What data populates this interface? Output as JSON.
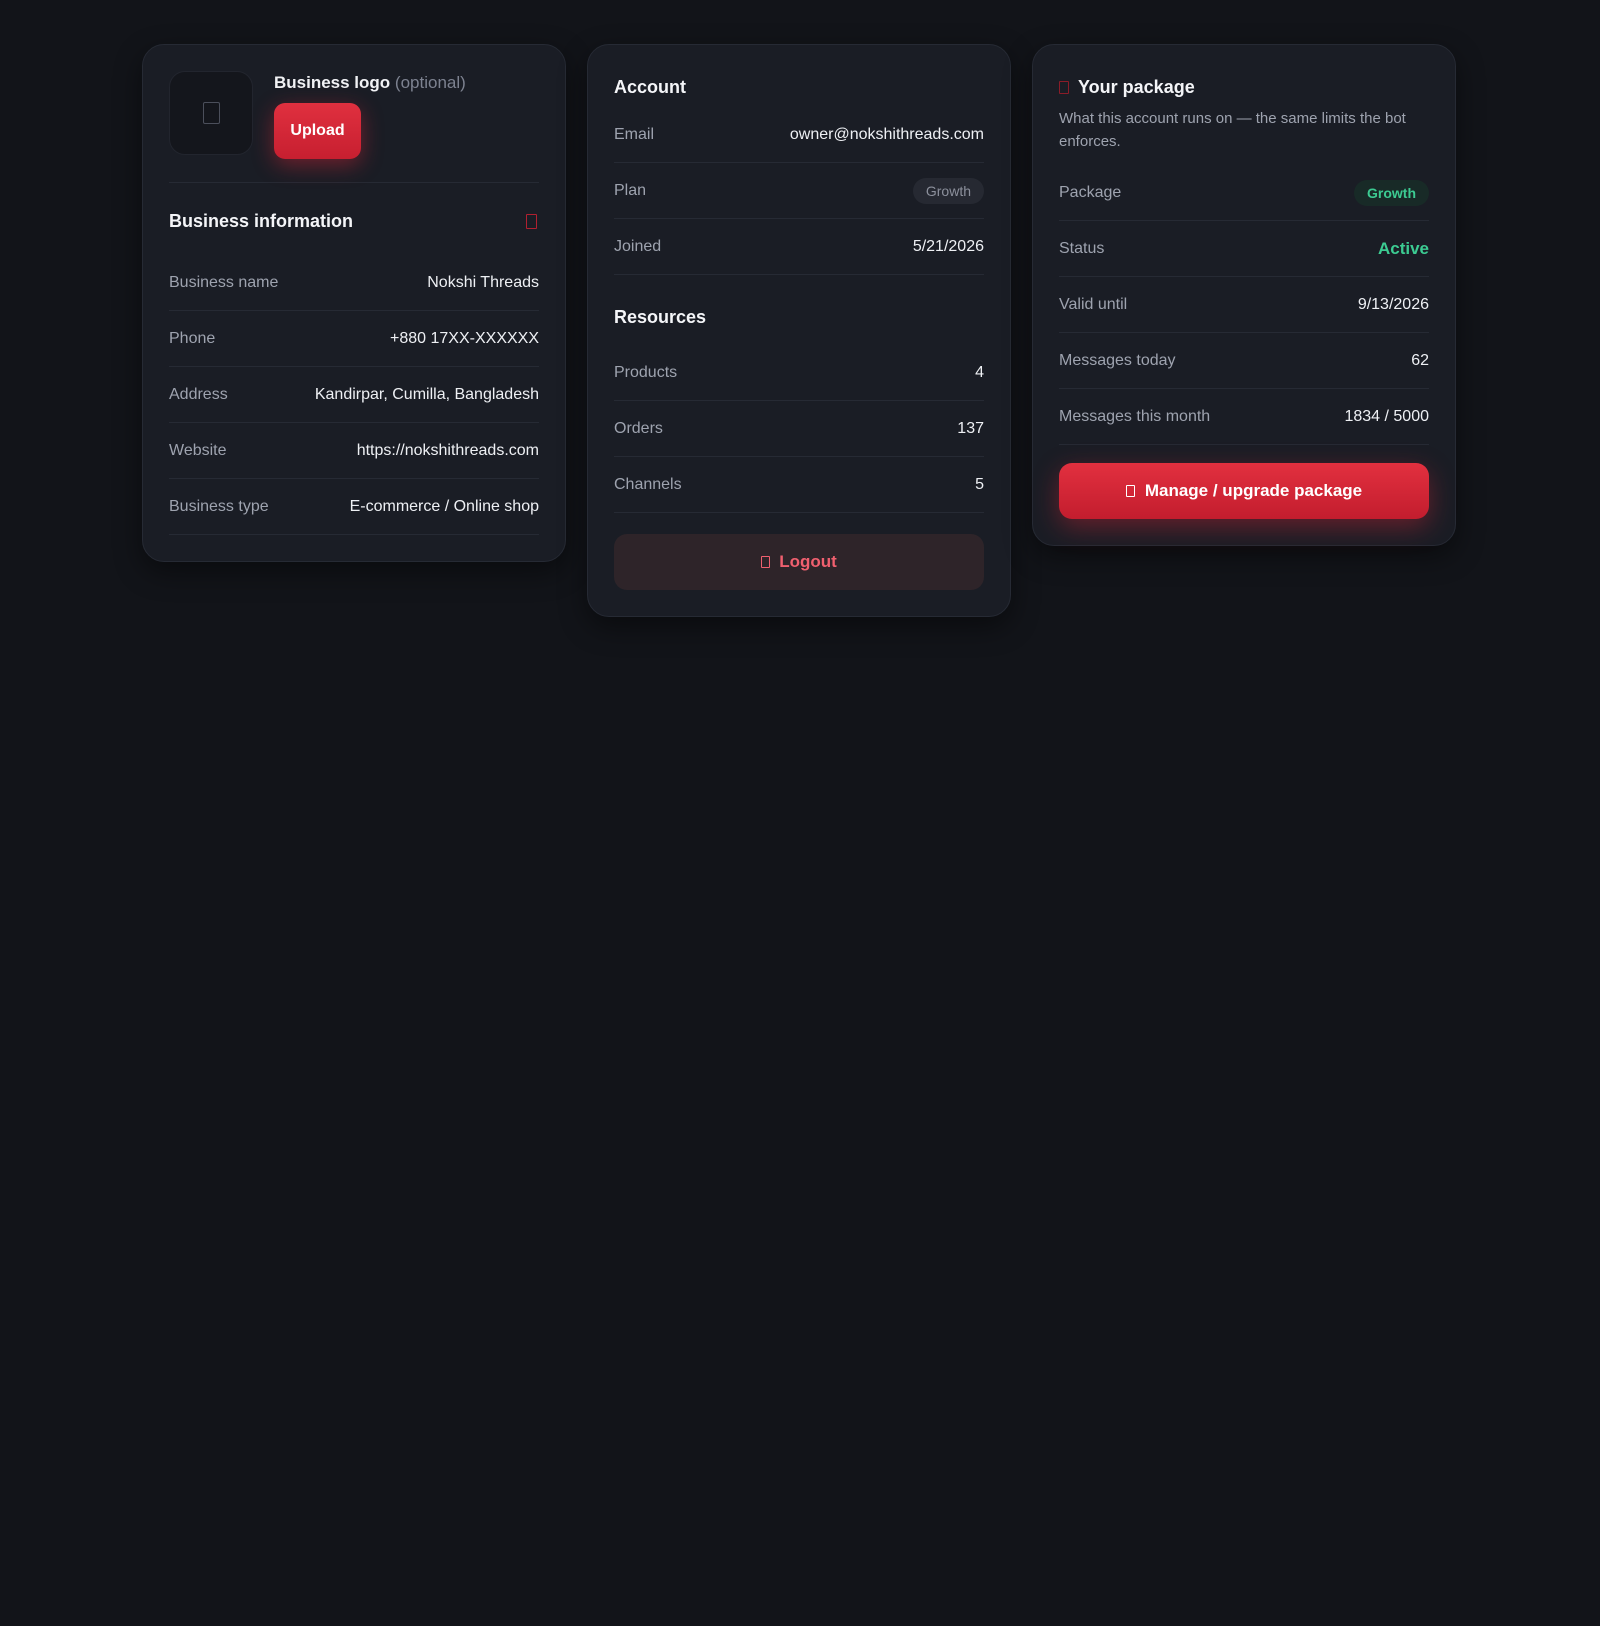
{
  "business_card": {
    "logo_label": "Business logo",
    "logo_optional": "(optional)",
    "upload_label": "Upload",
    "section_title": "Business information",
    "fields": [
      {
        "label": "Business name",
        "value": "Nokshi Threads"
      },
      {
        "label": "Phone",
        "value": "+880 17XX-XXXXXX"
      },
      {
        "label": "Address",
        "value": "Kandirpar, Cumilla, Bangladesh"
      },
      {
        "label": "Website",
        "value": "https://nokshithreads.com"
      },
      {
        "label": "Business type",
        "value": "E-commerce / Online shop"
      }
    ]
  },
  "account_card": {
    "title": "Account",
    "email_label": "Email",
    "email_value": "owner@nokshithreads.com",
    "plan_label": "Plan",
    "plan_value": "Growth",
    "joined_label": "Joined",
    "joined_value": "5/21/2026",
    "resources_title": "Resources",
    "resources": [
      {
        "label": "Products",
        "value": "4"
      },
      {
        "label": "Orders",
        "value": "137"
      },
      {
        "label": "Channels",
        "value": "5"
      }
    ],
    "logout_label": "Logout"
  },
  "package_card": {
    "title": "Your package",
    "description": "What this account runs on — the same limits the bot enforces.",
    "package_label": "Package",
    "package_value": "Growth",
    "status_label": "Status",
    "status_value": "Active",
    "valid_label": "Valid until",
    "valid_value": "9/13/2026",
    "msg_today_label": "Messages today",
    "msg_today_value": "62",
    "msg_month_label": "Messages this month",
    "msg_month_value": "1834 / 5000",
    "manage_label": "Manage / upgrade package"
  },
  "icons": {
    "logo_placeholder": "image-placeholder-icon",
    "edit": "edit-icon",
    "logout": "logout-icon",
    "package": "package-icon",
    "manage": "upgrade-icon"
  },
  "colors": {
    "background": "#121419",
    "card": "#1a1d25",
    "accent": "#dc2637",
    "success": "#3ccb92"
  }
}
